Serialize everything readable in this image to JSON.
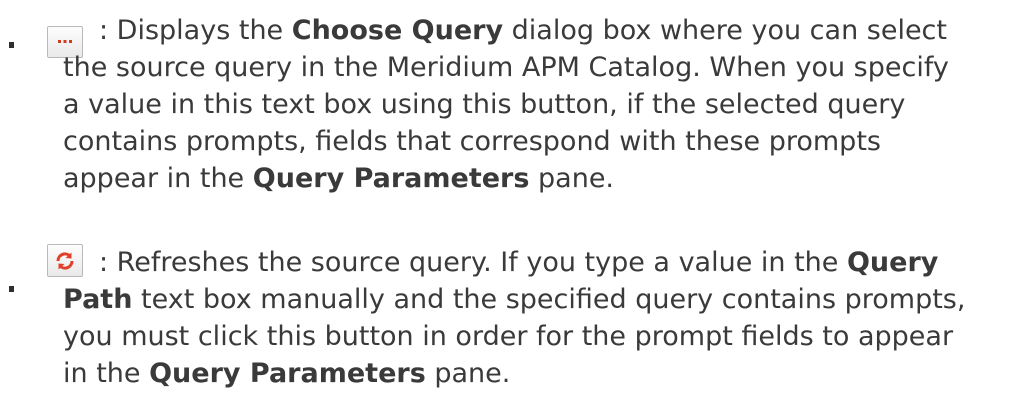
{
  "items": [
    {
      "icon": "ellipsis-icon",
      "lines": [
        [
          ": Displays the ",
          {
            "b": "Choose Query"
          },
          " dialog box where you can select"
        ],
        [
          "the source query in the Meridium APM Catalog. When you specify"
        ],
        [
          "a value in this text box using this button, if the selected query"
        ],
        [
          "contains prompts, fields that correspond with these prompts"
        ],
        [
          "appear in the ",
          {
            "b": "Query Parameters"
          },
          " pane."
        ]
      ]
    },
    {
      "icon": "refresh-icon",
      "lines": [
        [
          ": Refreshes the source query. If you type a value in the ",
          {
            "b": "Query"
          }
        ],
        [
          {
            "b": "Path"
          },
          " text box manually and the specified query contains prompts,"
        ],
        [
          "you must click this button in order for the prompt fields to appear"
        ],
        [
          "in the ",
          {
            "b": "Query Parameters"
          },
          " pane."
        ]
      ]
    }
  ],
  "colors": {
    "ellipsis_dots": "#d33a1f",
    "refresh_arrows": "#e0402a"
  }
}
